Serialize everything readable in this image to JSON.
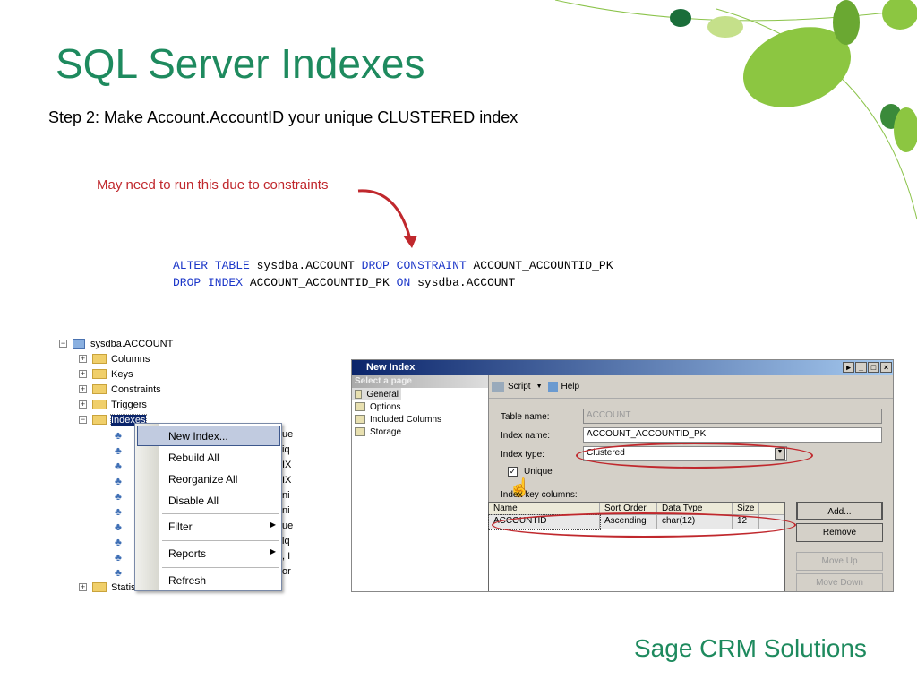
{
  "slide": {
    "title": "SQL Server Indexes",
    "subtitle": "Step 2:  Make Account.AccountID your unique CLUSTERED index",
    "note": "May need to run this due to constraints",
    "footer": "Sage CRM Solutions"
  },
  "code": {
    "line1": [
      {
        "t": "ALTER TABLE",
        "k": true
      },
      {
        "t": " sysdba.ACCOUNT ",
        "k": false
      },
      {
        "t": "DROP CONSTRAINT",
        "k": true
      },
      {
        "t": " ACCOUNT_ACCOUNTID_PK",
        "k": false
      }
    ],
    "line2": [
      {
        "t": "DROP INDEX",
        "k": true
      },
      {
        "t": " ACCOUNT_ACCOUNTID_PK ",
        "k": false
      },
      {
        "t": "ON",
        "k": true
      },
      {
        "t": " sysdba.ACCOUNT",
        "k": false
      }
    ]
  },
  "tree": {
    "root": "sysdba.ACCOUNT",
    "folders": [
      "Columns",
      "Keys",
      "Constraints",
      "Triggers",
      "Indexes"
    ],
    "last": "Statistics",
    "index_fragments": [
      "ue",
      "iq",
      "IX",
      "IX",
      "ni",
      "ni",
      "ue",
      "iq",
      ", I",
      "or"
    ]
  },
  "context_menu": {
    "items": [
      "New Index...",
      "Rebuild All",
      "Reorganize All",
      "Disable All",
      "Filter",
      "Reports",
      "Refresh"
    ]
  },
  "dialog": {
    "title": "New Index",
    "select_page": "Select a page",
    "pages": [
      "General",
      "Options",
      "Included Columns",
      "Storage"
    ],
    "toolbar": {
      "script": "Script",
      "help": "Help"
    },
    "table_name_label": "Table name:",
    "table_name": "ACCOUNT",
    "index_name_label": "Index name:",
    "index_name": "ACCOUNT_ACCOUNTID_PK",
    "index_type_label": "Index type:",
    "index_type": "Clustered",
    "unique_label": "Unique",
    "unique_checked": true,
    "key_columns_label": "Index key columns:",
    "columns": [
      "Name",
      "Sort Order",
      "Data Type",
      "Size"
    ],
    "rows": [
      [
        "ACCOUNTID",
        "Ascending",
        "char(12)",
        "12"
      ]
    ],
    "buttons": {
      "add": "Add...",
      "remove": "Remove",
      "move_up": "Move Up",
      "move_down": "Move Down"
    }
  }
}
